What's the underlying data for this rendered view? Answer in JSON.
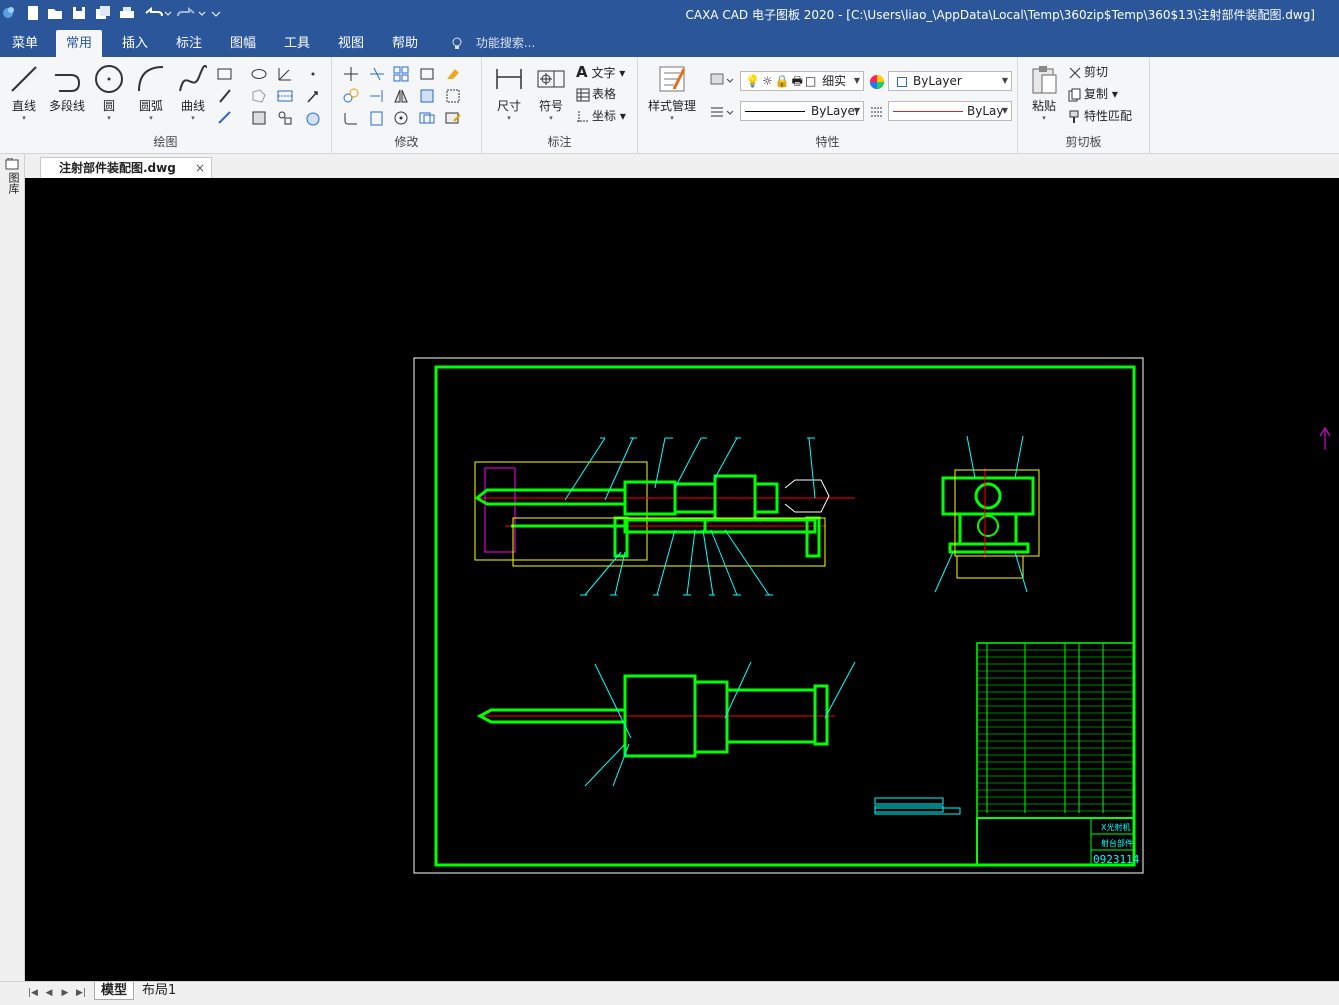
{
  "app": {
    "title": "CAXA CAD 电子图板 2020 - [C:\\Users\\liao_\\AppData\\Local\\Temp\\360zip$Temp\\360$13\\注射部件装配图.dwg]"
  },
  "menu": {
    "tabs": [
      "菜单",
      "常用",
      "插入",
      "标注",
      "图幅",
      "工具",
      "视图",
      "帮助"
    ],
    "active_tab": "常用",
    "search_placeholder": "功能搜索..."
  },
  "ribbon": {
    "draw": {
      "label": "绘图",
      "buttons": [
        "直线",
        "多段线",
        "圆",
        "圆弧",
        "曲线"
      ]
    },
    "modify": {
      "label": "修改"
    },
    "annotate": {
      "label": "标注",
      "buttons": [
        "尺寸",
        "符号"
      ],
      "small": [
        "文字",
        "表格",
        "坐标"
      ]
    },
    "properties": {
      "label": "特性",
      "style_manager": "样式管理",
      "layer_combo": "细实",
      "color_combo": "ByLayer",
      "linetype_combo": "ByLayer",
      "lineweight_combo": "ByLay"
    },
    "clipboard": {
      "label": "剪切板",
      "paste": "粘贴",
      "cut": "剪切",
      "copy": "复制",
      "match": "特性匹配"
    }
  },
  "document": {
    "tab_name": "注射部件装配图.dwg",
    "close_glyph": "×",
    "sidebar_label": "图库"
  },
  "drawing": {
    "title_block_code": "0923114",
    "title_block_name": "X光射机",
    "title_block_sub": "射台部件"
  },
  "layout_tabs": [
    "模型",
    "布局1"
  ],
  "active_layout": "模型",
  "colors": {
    "titlebar": "#2b579a",
    "canvas": "#000000",
    "drawing_green": "#00ff00",
    "dimension_yellow": "#ffff00",
    "leader_cyan": "#00ffff",
    "centerline_red": "#ff0000"
  }
}
